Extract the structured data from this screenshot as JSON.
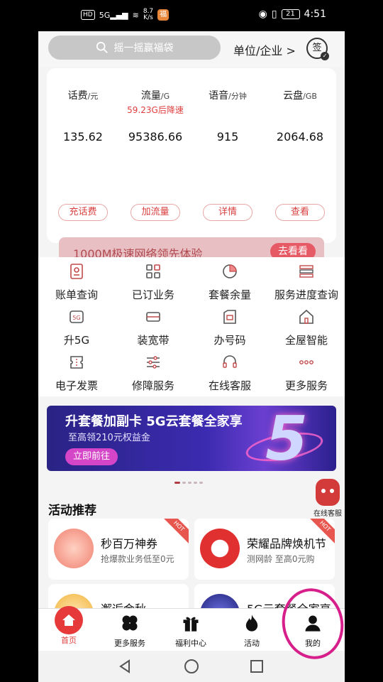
{
  "status": {
    "net_speed_value": "8.7",
    "net_speed_unit": "K/s",
    "battery": "21",
    "time": "4:51"
  },
  "topbar": {
    "search_placeholder": "摇一摇赢福袋",
    "unit_link": "单位/企业 >",
    "sign_label": "签"
  },
  "balance": {
    "metrics": [
      {
        "label": "话费",
        "unit": "/元",
        "sub": "",
        "value": "135.62"
      },
      {
        "label": "流量",
        "unit": "/G",
        "sub": "59.23G后降速",
        "value": "95386.66"
      },
      {
        "label": "语音",
        "unit": "/分钟",
        "sub": "",
        "value": "915"
      },
      {
        "label": "云盘",
        "unit": "/GB",
        "sub": "",
        "value": "2064.68"
      }
    ],
    "buttons": [
      "充话费",
      "加流量",
      "详情",
      "查看"
    ],
    "promo_text": "1000M极速网络领先体验",
    "promo_button": "去看看"
  },
  "services": [
    {
      "label": "账单查询",
      "icon": "bill-icon"
    },
    {
      "label": "已订业务",
      "icon": "grid-apps-icon"
    },
    {
      "label": "套餐余量",
      "icon": "pie-chart-icon"
    },
    {
      "label": "服务进度查询",
      "icon": "progress-icon"
    },
    {
      "label": "升5G",
      "icon": "5g-icon"
    },
    {
      "label": "装宽带",
      "icon": "router-icon"
    },
    {
      "label": "办号码",
      "icon": "sim-card-icon"
    },
    {
      "label": "全屋智能",
      "icon": "smart-home-icon"
    },
    {
      "label": "电子发票",
      "icon": "invoice-icon"
    },
    {
      "label": "修障服务",
      "icon": "sliders-icon"
    },
    {
      "label": "在线客服",
      "icon": "headset-icon"
    },
    {
      "label": "更多服务",
      "icon": "more-dots-icon"
    }
  ],
  "banner": {
    "title": "升套餐加副卡 5G云套餐全家享",
    "subtitle": "至高领210元权益金",
    "button": "立即前往",
    "big_number": "5"
  },
  "activities": {
    "section_title": "活动推荐",
    "floating_service": "在线客服",
    "cards": [
      {
        "title": "秒百万神券",
        "desc": "抢爆款业务低至0元",
        "badge": "HOT"
      },
      {
        "title": "荣耀品牌焕机节",
        "desc": "测网龄 至高0元购",
        "badge": "HOT"
      },
      {
        "title": "邂逅金秋",
        "desc": "",
        "badge": ""
      },
      {
        "title": "5G云套餐全家享",
        "desc": "",
        "badge": ""
      }
    ]
  },
  "tabbar": [
    {
      "label": "首页",
      "icon": "home-icon",
      "active": true
    },
    {
      "label": "更多服务",
      "icon": "clover-icon",
      "active": false
    },
    {
      "label": "福利中心",
      "icon": "gift-icon",
      "active": false
    },
    {
      "label": "活动",
      "icon": "flame-icon",
      "active": false
    },
    {
      "label": "我的",
      "icon": "person-icon",
      "active": false
    }
  ],
  "colors": {
    "accent": "#e03e3e",
    "annotation": "#d61f8a"
  }
}
